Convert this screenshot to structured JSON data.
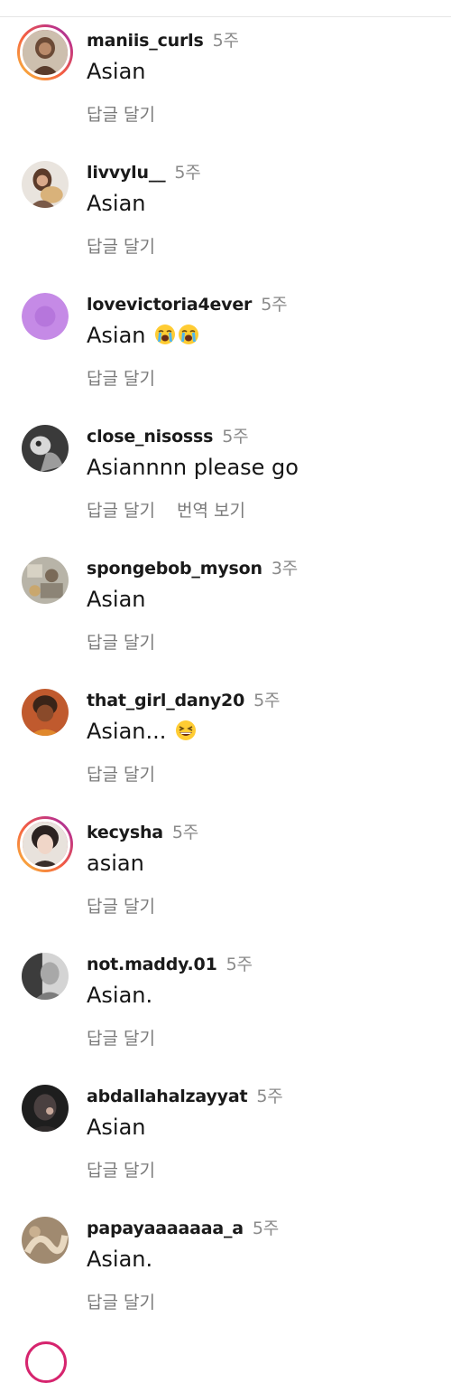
{
  "comments": [
    {
      "username": "maniis_curls",
      "time": "5주",
      "text": "Asian",
      "reply": "답글 달기",
      "avatar_icon": "profile-photo-icon",
      "story_ring": true
    },
    {
      "username": "livvylu__",
      "time": "5주",
      "text": "Asian",
      "reply": "답글 달기",
      "avatar_icon": "profile-photo-icon",
      "story_ring": false
    },
    {
      "username": "lovevictoria4ever",
      "time": "5주",
      "text": "Asian",
      "emojis": [
        "loudly-crying-face-emoji",
        "loudly-crying-face-emoji"
      ],
      "reply": "답글 달기",
      "avatar_icon": "purple-circle-avatar-icon",
      "story_ring": false
    },
    {
      "username": "close_nisosss",
      "time": "5주",
      "text": "Asiannnn please go",
      "reply": "답글 달기",
      "translate": "번역 보기",
      "avatar_icon": "profile-photo-icon",
      "story_ring": false
    },
    {
      "username": "spongebob_myson",
      "time": "3주",
      "text": "Asian",
      "reply": "답글 달기",
      "avatar_icon": "profile-photo-icon",
      "story_ring": false
    },
    {
      "username": "that_girl_dany20",
      "time": "5주",
      "text": "Asian...",
      "emojis": [
        "grinning-squinting-face-emoji"
      ],
      "reply": "답글 달기",
      "avatar_icon": "profile-photo-icon",
      "story_ring": false
    },
    {
      "username": "kecysha",
      "time": "5주",
      "text": "asian",
      "reply": "답글 달기",
      "avatar_icon": "profile-photo-icon",
      "story_ring": true
    },
    {
      "username": "not.maddy.01",
      "time": "5주",
      "text": "Asian.",
      "reply": "답글 달기",
      "avatar_icon": "profile-photo-icon",
      "story_ring": false
    },
    {
      "username": "abdallahalzayyat",
      "time": "5주",
      "text": "Asian",
      "reply": "답글 달기",
      "avatar_icon": "profile-photo-icon",
      "story_ring": false
    },
    {
      "username": "papayaaaaaaa_a",
      "time": "5주",
      "text": "Asian.",
      "reply": "답글 달기",
      "avatar_icon": "profile-photo-icon",
      "story_ring": false
    }
  ],
  "colors": {
    "username": "#1a1a1a",
    "muted": "#8a8a8a",
    "story_ring": [
      "#f9c23c",
      "#f56040",
      "#c13584",
      "#833ab4"
    ],
    "purple_avatar": "#c58ae6"
  }
}
